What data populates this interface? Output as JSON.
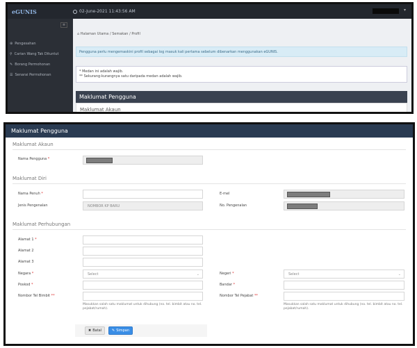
{
  "topbar": {
    "logo": "eGUNIS",
    "datetime": "02-June-2021 11:43:56 AM"
  },
  "sidebar": {
    "items": [
      {
        "label": "Pengesahan",
        "icon": "badge-icon"
      },
      {
        "label": "Carian Wang Tak Dituntut",
        "icon": "search-icon"
      },
      {
        "label": "Borang Permohonan",
        "icon": "form-icon"
      },
      {
        "label": "Senarai Permohonan",
        "icon": "list-icon"
      }
    ]
  },
  "breadcrumb": {
    "home": "Halaman Utama",
    "sep1": "/",
    "section": "Semakan",
    "sep2": "/",
    "current": "Profil"
  },
  "info_message": "Pengguna perlu mengemaskini profil sebagai log masuk kali pertama sebelum dibenarkan menggunakan eGUNIS.",
  "warnings": {
    "line1": "* Medan ini adalah wajib.",
    "line2": "** Sekurang-kurangnya satu daripada medan adalah wajib."
  },
  "section_title": "Maklumat Pengguna",
  "account_heading": "Maklumat Akaun",
  "form": {
    "title": "Maklumat Pengguna",
    "akaun": {
      "heading": "Maklumat Akaun",
      "username_label": "Nama Pengguna",
      "req": "*"
    },
    "diri": {
      "heading": "Maklumat Diri",
      "name_label": "Nama Penuh",
      "req": "*",
      "email_label": "E-mel",
      "idtype_label": "Jenis Pengenalan",
      "idtype_value": "NOMBOR KP BARU",
      "idno_label": "No. Pengenalan"
    },
    "hubungan": {
      "heading": "Maklumat Perhubungan",
      "addr1_label": "Alamat 1",
      "addr2_label": "Alamat 2",
      "addr3_label": "Alamat 3",
      "country_label": "Negara",
      "state_label": "Negeri",
      "select_placeholder": "Select",
      "postcode_label": "Poskod",
      "city_label": "Bandar",
      "mobile_label": "Nombor Tel Bimbit",
      "office_label": "Nombor Tel Pejabat",
      "req2": "**",
      "help_text": "Masukkan salah satu maklumat untuk dihubung (no. tel. bimbit atau no. tel. pejabat/rumah)."
    },
    "buttons": {
      "cancel": "Batal",
      "save": "Simpan"
    }
  },
  "colors": {
    "topbar": "#23272e",
    "sidebar": "#2b2f36",
    "header": "#2a3b52",
    "save": "#3a8ee6",
    "info": "#d8ecf6"
  }
}
